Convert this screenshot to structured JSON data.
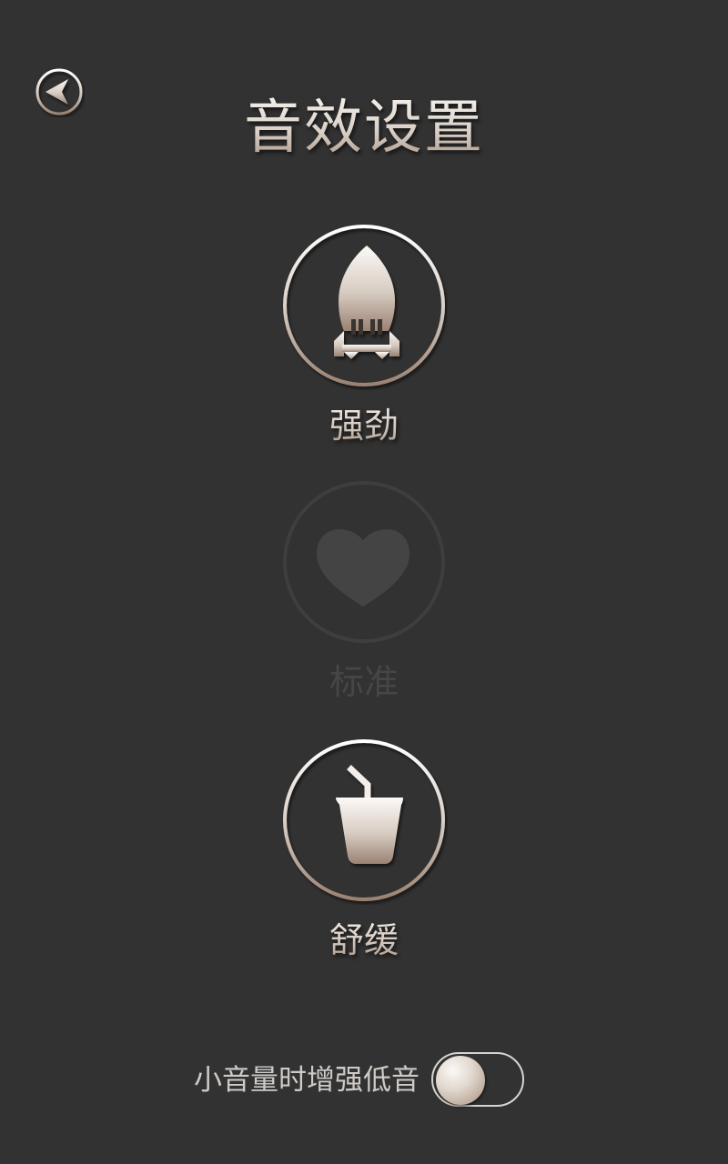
{
  "header": {
    "title": "音效设置",
    "back_icon": "back-arrow-icon"
  },
  "modes": [
    {
      "label": "强劲",
      "icon": "rocket-icon",
      "state": "enabled"
    },
    {
      "label": "标准",
      "icon": "heart-icon",
      "state": "disabled"
    },
    {
      "label": "舒缓",
      "icon": "drink-cup-icon",
      "state": "enabled"
    }
  ],
  "bass_boost": {
    "label": "小音量时增强低音",
    "enabled": false
  },
  "colors": {
    "background": "#323232",
    "accent_light": "#f5efe9",
    "accent_dark": "#a08a7b",
    "inactive": "#474646"
  }
}
